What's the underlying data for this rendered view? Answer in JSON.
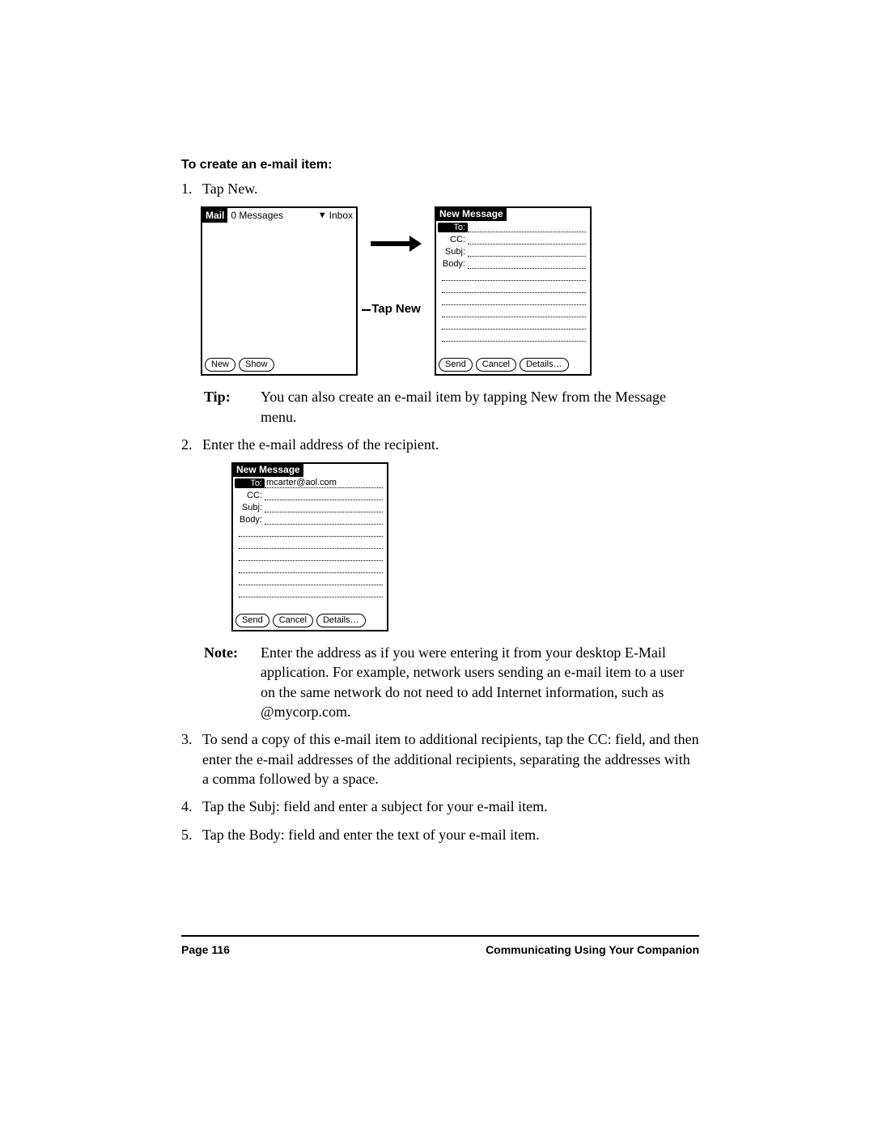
{
  "heading": "To create an e-mail item:",
  "steps": {
    "s1_num": "1.",
    "s1_text": "Tap New.",
    "s2_num": "2.",
    "s2_text": "Enter the e-mail address of the recipient.",
    "s3_num": "3.",
    "s3_text": "To send a copy of this e-mail item to additional recipients, tap the CC: field, and then enter the e-mail addresses of the additional recipients, separating the addresses with a comma followed by a space.",
    "s4_num": "4.",
    "s4_text": "Tap the Subj: field and enter a subject for your e-mail item.",
    "s5_num": "5.",
    "s5_text": "Tap the Body: field and enter the text of your e-mail item."
  },
  "tip": {
    "label": "Tip:",
    "text": "You can also create an e-mail item by tapping New from the Message menu."
  },
  "note": {
    "label": "Note:",
    "text": "Enter the address as if you were entering it from your desktop E-Mail application. For example, network users sending an e-mail item to a user on the same network do not need to add Internet information, such as @mycorp.com."
  },
  "mail_device": {
    "app": "Mail",
    "msg_count": "0 Messages",
    "folder": "Inbox",
    "new_btn": "New",
    "show_btn": "Show"
  },
  "arrow_label": "Tap New",
  "new_message": {
    "title": "New Message",
    "to_label": "To:",
    "cc_label": "CC:",
    "subj_label": "Subj:",
    "body_label": "Body:",
    "send_btn": "Send",
    "cancel_btn": "Cancel",
    "details_btn": "Details…"
  },
  "new_message_filled": {
    "to_value": "mcarter@aol.com"
  },
  "footer": {
    "page": "Page 116",
    "chapter": "Communicating Using Your Companion"
  }
}
